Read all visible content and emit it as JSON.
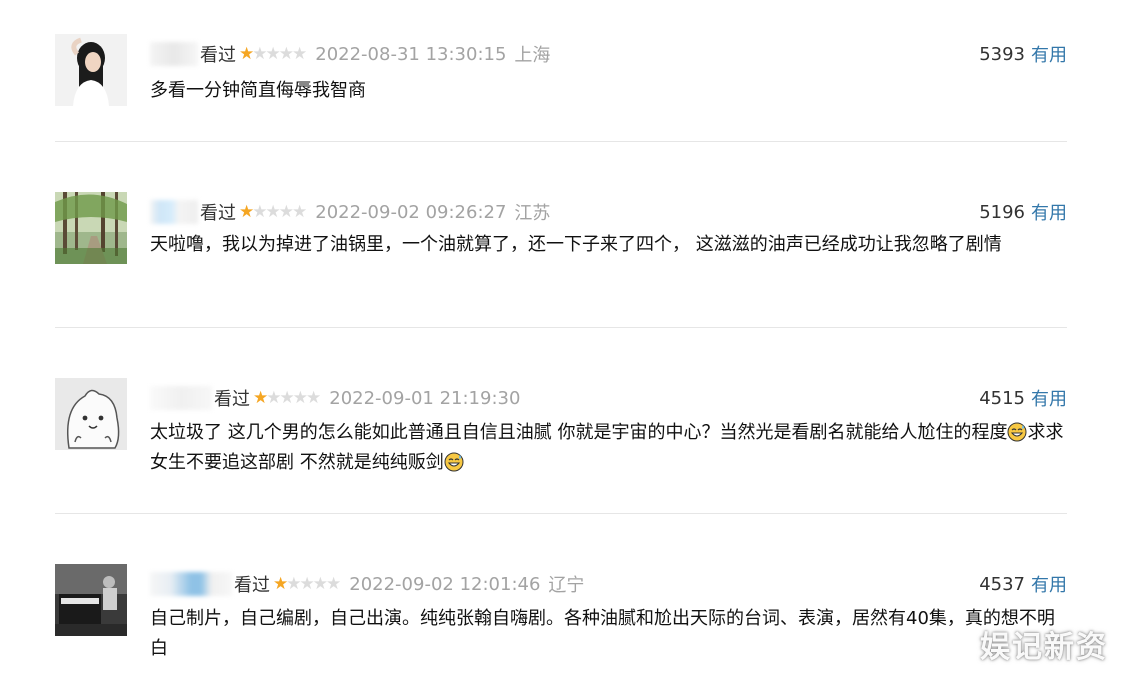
{
  "comments": [
    {
      "status": "看过",
      "rating_stars": 1,
      "datetime": "2022-08-31 13:30:15",
      "location": "上海",
      "votes": "5393",
      "useful_label": "有用",
      "text": "多看一分钟简直侮辱我智商",
      "avatar_icon": "girl-photo-avatar"
    },
    {
      "status": "看过",
      "rating_stars": 1,
      "datetime": "2022-09-02 09:26:27",
      "location": "江苏",
      "votes": "5196",
      "useful_label": "有用",
      "text": "天啦噜，我以为掉进了油锅里，一个油就算了，还一下子来了四个， 这滋滋的油声已经成功让我忽略了剧情",
      "avatar_icon": "forest-path-avatar"
    },
    {
      "status": "看过",
      "rating_stars": 1,
      "datetime": "2022-09-01 21:19:30",
      "location": "",
      "votes": "4515",
      "useful_label": "有用",
      "text_parts": [
        "太垃圾了 这几个男的怎么能如此普通且自信且油腻 你就是宇宙的中心？当然光是看剧名就能给人尬住的程度",
        "求求女生不要追这部剧 不然就是纯纯贩剑",
        ""
      ],
      "avatar_icon": "cartoon-blob-avatar"
    },
    {
      "status": "看过",
      "rating_stars": 1,
      "datetime": "2022-09-02 12:01:46",
      "location": "辽宁",
      "votes": "4537",
      "useful_label": "有用",
      "text": "自己制片，自己编剧，自己出演。纯纯张翰自嗨剧。各种油腻和尬出天际的台词、表演，居然有40集，真的想不明白",
      "avatar_icon": "piano-man-avatar"
    }
  ],
  "watermark": "娱记新资",
  "colors": {
    "star_on": "#f5a623",
    "star_off": "#dcdcdc",
    "useful_link": "#3377aa",
    "meta_gray": "#a3a3a3",
    "divider": "#e6e6e6"
  }
}
